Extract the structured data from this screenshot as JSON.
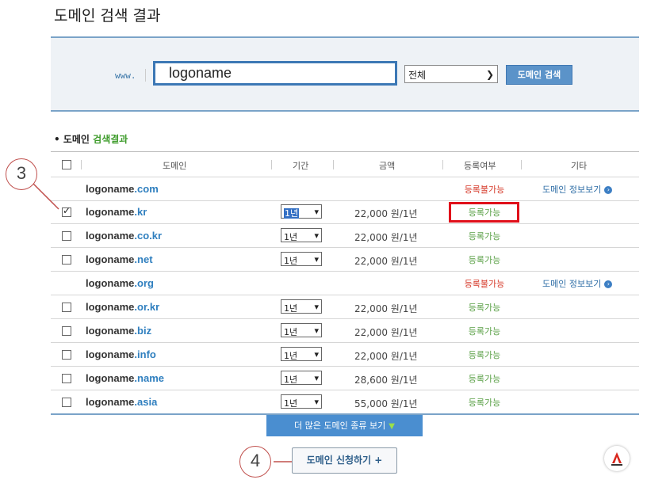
{
  "page": {
    "title": "도메인 검색 결과"
  },
  "search": {
    "prefix": "www.",
    "query": "logoname",
    "tld_selected": "전체",
    "button_label": "도메인 검색"
  },
  "results": {
    "label_prefix": "• 도메인",
    "label_highlight": "검색결과",
    "headers": {
      "domain": "도메인",
      "period": "기간",
      "price": "금액",
      "status": "등록여부",
      "etc": "기타"
    },
    "rows": [
      {
        "name": "logoname",
        "tld": ".com",
        "checkbox": false,
        "checked": false,
        "period": "",
        "price": "",
        "status": "등록불가능",
        "available": false,
        "etc": "도메인 정보보기"
      },
      {
        "name": "logoname",
        "tld": ".kr",
        "checkbox": true,
        "checked": true,
        "period": "1년",
        "price": "22,000 원/1년",
        "status": "등록가능",
        "available": true,
        "etc": ""
      },
      {
        "name": "logoname",
        "tld": ".co.kr",
        "checkbox": true,
        "checked": false,
        "period": "1년",
        "price": "22,000 원/1년",
        "status": "등록가능",
        "available": true,
        "etc": ""
      },
      {
        "name": "logoname",
        "tld": ".net",
        "checkbox": true,
        "checked": false,
        "period": "1년",
        "price": "22,000 원/1년",
        "status": "등록가능",
        "available": true,
        "etc": ""
      },
      {
        "name": "logoname",
        "tld": ".org",
        "checkbox": false,
        "checked": false,
        "period": "",
        "price": "",
        "status": "등록불가능",
        "available": false,
        "etc": "도메인 정보보기"
      },
      {
        "name": "logoname",
        "tld": ".or.kr",
        "checkbox": true,
        "checked": false,
        "period": "1년",
        "price": "22,000 원/1년",
        "status": "등록가능",
        "available": true,
        "etc": ""
      },
      {
        "name": "logoname",
        "tld": ".biz",
        "checkbox": true,
        "checked": false,
        "period": "1년",
        "price": "22,000 원/1년",
        "status": "등록가능",
        "available": true,
        "etc": ""
      },
      {
        "name": "logoname",
        "tld": ".info",
        "checkbox": true,
        "checked": false,
        "period": "1년",
        "price": "22,000 원/1년",
        "status": "등록가능",
        "available": true,
        "etc": ""
      },
      {
        "name": "logoname",
        "tld": ".name",
        "checkbox": true,
        "checked": false,
        "period": "1년",
        "price": "28,600 원/1년",
        "status": "등록가능",
        "available": true,
        "etc": ""
      },
      {
        "name": "logoname",
        "tld": ".asia",
        "checkbox": true,
        "checked": false,
        "period": "1년",
        "price": "55,000 원/1년",
        "status": "등록가능",
        "available": true,
        "etc": ""
      }
    ]
  },
  "more_button": "더 많은 도메인 종류 보기",
  "apply_button": "도메인 신청하기 +",
  "annotations": {
    "step3": "3",
    "step4": "4"
  },
  "colors": {
    "accent": "#4a8ed0",
    "available": "#5aa046",
    "unavailable": "#d63a2a",
    "highlight": "#e0101a"
  },
  "icons": {
    "logo": "brand-logo-icon",
    "go": "circle-arrow-icon"
  }
}
